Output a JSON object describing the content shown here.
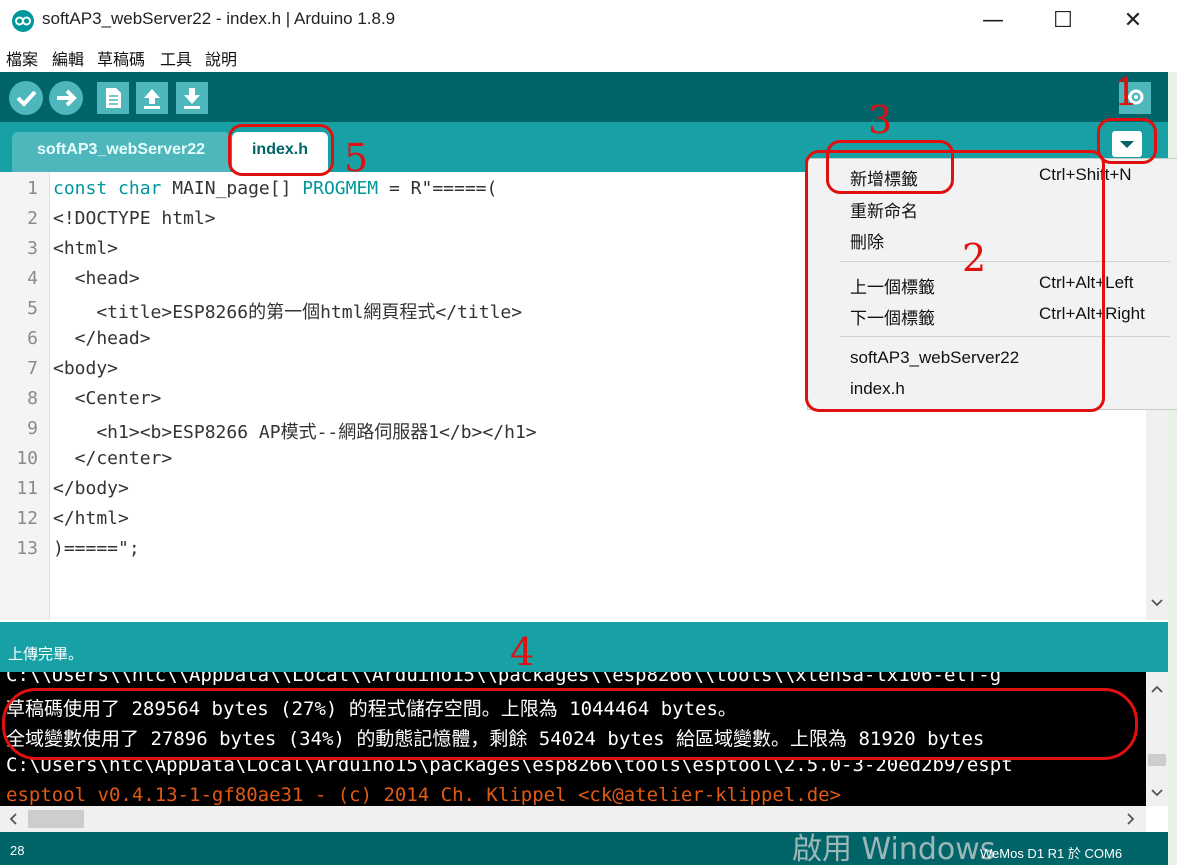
{
  "window": {
    "title": "softAP3_webServer22 - index.h | Arduino 1.8.9",
    "minimize": "—",
    "maximize": "☐",
    "close": "✕"
  },
  "menu": [
    "檔案",
    "編輯",
    "草稿碼",
    "工具",
    "說明"
  ],
  "toolbar": {
    "verify_icon": "check-icon",
    "upload_icon": "arrow-right-icon",
    "new_icon": "file-icon",
    "open_icon": "arrow-up-icon",
    "save_icon": "arrow-down-icon",
    "serial_icon": "magnifier-icon"
  },
  "tabs": [
    {
      "label": "softAP3_webServer22",
      "active": false
    },
    {
      "label": "index.h",
      "active": true
    }
  ],
  "editor": {
    "lines": [
      {
        "n": "1",
        "text": ""
      },
      {
        "n": "2",
        "text": "<!DOCTYPE html>"
      },
      {
        "n": "3",
        "text": "<html>"
      },
      {
        "n": "4",
        "text": "  <head>"
      },
      {
        "n": "5",
        "text": "    <title>ESP8266的第一個html網頁程式</title>"
      },
      {
        "n": "6",
        "text": "  </head>"
      },
      {
        "n": "7",
        "text": "<body>"
      },
      {
        "n": "8",
        "text": "  <Center>"
      },
      {
        "n": "9",
        "text": "    <h1><b>ESP8266 AP模式--網路伺服器1</b></h1>"
      },
      {
        "n": "10",
        "text": "  </center>"
      },
      {
        "n": "11",
        "text": "</body>"
      },
      {
        "n": "12",
        "text": "</html>"
      },
      {
        "n": "13",
        "text": ")=====\";"
      }
    ],
    "line1": {
      "k1": "const",
      "k2": "char",
      "mid": " MAIN_page[] ",
      "k3": "PROGMEM",
      "rest": " = R\"=====("
    }
  },
  "status_message": "上傳完畢。",
  "console": {
    "lines": [
      {
        "text": "C:\\\\Users\\\\htc\\\\AppData\\\\Local\\\\Arduino15\\\\packages\\\\esp8266\\\\tools\\\\xtensa-lx106-elf-g",
        "color": "#ffffff"
      },
      {
        "text": "草稿碼使用了 289564 bytes (27%) 的程式儲存空間。上限為 1044464 bytes。",
        "color": "#ffffff"
      },
      {
        "text": "全域變數使用了 27896 bytes (34%) 的動態記憶體，剩餘 54024 bytes 給區域變數。上限為 81920 bytes",
        "color": "#ffffff"
      },
      {
        "text": "C:\\Users\\htc\\AppData\\Local\\Arduino15\\packages\\esp8266\\tools\\esptool\\2.5.0-3-20ed2b9/espt",
        "color": "#ffffff"
      },
      {
        "text": "esptool v0.4.13-1-gf80ae31 - (c) 2014 Ch. Klippel <ck@atelier-klippel.de>",
        "color": "#e05a14"
      }
    ]
  },
  "bottom": {
    "line": "28",
    "board": "WeMos D1 R1 於 COM6",
    "watermark": "啟用 Windows"
  },
  "tab_menu": {
    "items": [
      {
        "label": "新增標籤",
        "shortcut": "Ctrl+Shift+N"
      },
      {
        "label": "重新命名",
        "shortcut": ""
      },
      {
        "label": "刪除",
        "shortcut": ""
      },
      {
        "label": "上一個標籤",
        "shortcut": "Ctrl+Alt+Left"
      },
      {
        "label": "下一個標籤",
        "shortcut": "Ctrl+Alt+Right"
      },
      {
        "label": "softAP3_webServer22",
        "shortcut": ""
      },
      {
        "label": "index.h",
        "shortcut": ""
      }
    ]
  },
  "annotations": [
    "1",
    "2",
    "3",
    "4",
    "5"
  ],
  "colors": {
    "accent": "#00979c",
    "dark_teal": "#006468",
    "tab_bar": "#17a1a5",
    "annotation": "#e01010"
  }
}
